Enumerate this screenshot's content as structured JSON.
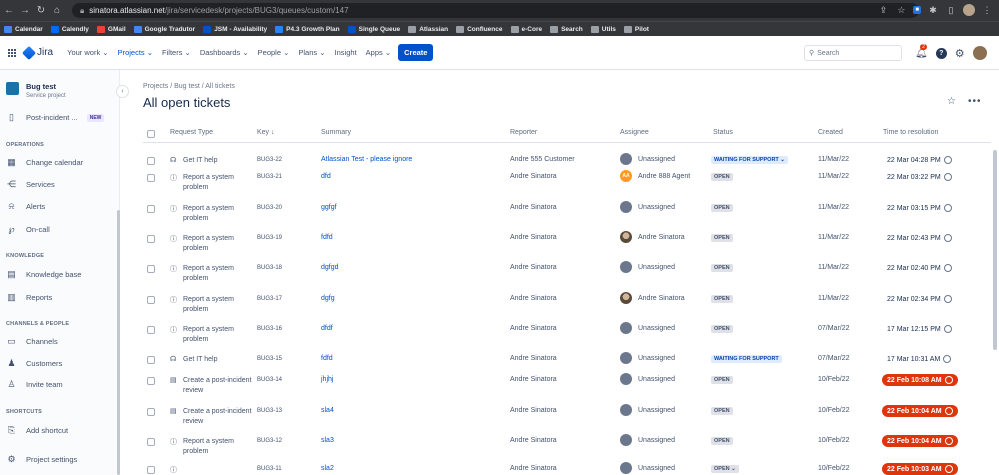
{
  "browser": {
    "url_host": "sinatora.atlassian.net",
    "url_path": "/jira/servicedesk/projects/BUG3/queues/custom/147",
    "bookmarks": [
      "Calendar",
      "Calendly",
      "GMail",
      "Google Tradutor",
      "JSM - Availability",
      "P4.3 Growth Plan",
      "Single Queue",
      "Atlassian",
      "Confluence",
      "e-Core",
      "Search",
      "Utils",
      "Pilot"
    ]
  },
  "nav": {
    "logo": "Jira",
    "items": [
      "Your work ⌄",
      "Projects ⌄",
      "Filters ⌄",
      "Dashboards ⌄",
      "People ⌄",
      "Plans ⌄",
      "Insight",
      "Apps ⌄"
    ],
    "create": "Create",
    "search_placeholder": "Search",
    "notifications": "2"
  },
  "sidebar": {
    "project_name": "Bug test",
    "project_type": "Service project",
    "post_incident": "Post-incident ...",
    "new_badge": "NEW",
    "operations_head": "OPERATIONS",
    "operations": [
      "Change calendar",
      "Services",
      "Alerts",
      "On-call"
    ],
    "knowledge_head": "KNOWLEDGE",
    "knowledge": [
      "Knowledge base",
      "Reports"
    ],
    "channels_head": "CHANNELS & PEOPLE",
    "channels": [
      "Channels",
      "Customers",
      "Invite team"
    ],
    "shortcuts_head": "SHORTCUTS",
    "add_shortcut": "Add shortcut",
    "project_settings": "Project settings"
  },
  "page": {
    "breadcrumb": "Projects  /  Bug test  /  All tickets",
    "title": "All open tickets"
  },
  "table": {
    "headers": [
      "Request Type",
      "Key ↓",
      "Summary",
      "Reporter",
      "Assignee",
      "Status",
      "Created",
      "Time to resolution"
    ],
    "rows": [
      {
        "type": "Get IT help",
        "key": "BUG3-22",
        "summary": "Atlassian Test - please ignore",
        "reporter": "Andre 555 Customer",
        "assignee": "Unassigned",
        "status": "WAITING FOR SUPPORT ⌄",
        "created": "11/Mar/22",
        "ttr": "22 Mar 04:28 PM"
      },
      {
        "type": "Report a system problem",
        "key": "BUG3-21",
        "summary": "dfd",
        "reporter": "Andre Sinatora",
        "assignee": "Andre 888 Agent",
        "status": "OPEN",
        "created": "11/Mar/22",
        "ttr": "22 Mar 03:22 PM"
      },
      {
        "type": "Report a system problem",
        "key": "BUG3-20",
        "summary": "ggfgf",
        "reporter": "Andre Sinatora",
        "assignee": "Unassigned",
        "status": "OPEN",
        "created": "11/Mar/22",
        "ttr": "22 Mar 03:15 PM"
      },
      {
        "type": "Report a system problem",
        "key": "BUG3-19",
        "summary": "fdfd",
        "reporter": "Andre Sinatora",
        "assignee": "Andre Sinatora",
        "status": "OPEN",
        "created": "11/Mar/22",
        "ttr": "22 Mar 02:43 PM"
      },
      {
        "type": "Report a system problem",
        "key": "BUG3-18",
        "summary": "dgfgd",
        "reporter": "Andre Sinatora",
        "assignee": "Unassigned",
        "status": "OPEN",
        "created": "11/Mar/22",
        "ttr": "22 Mar 02:40 PM"
      },
      {
        "type": "Report a system problem",
        "key": "BUG3-17",
        "summary": "dgfg",
        "reporter": "Andre Sinatora",
        "assignee": "Andre Sinatora",
        "status": "OPEN",
        "created": "11/Mar/22",
        "ttr": "22 Mar 02:34 PM"
      },
      {
        "type": "Report a system problem",
        "key": "BUG3-16",
        "summary": "dfdf",
        "reporter": "Andre Sinatora",
        "assignee": "Unassigned",
        "status": "OPEN",
        "created": "07/Mar/22",
        "ttr": "17 Mar 12:15 PM"
      },
      {
        "type": "Get IT help",
        "key": "BUG3-15",
        "summary": "fdfd",
        "reporter": "Andre Sinatora",
        "assignee": "Unassigned",
        "status": "WAITING FOR SUPPORT",
        "created": "07/Mar/22",
        "ttr": "17 Mar 10:31 AM"
      },
      {
        "type": "Create a post-incident review",
        "key": "BUG3-14",
        "summary": "jhjhj",
        "reporter": "Andre Sinatora",
        "assignee": "Unassigned",
        "status": "OPEN",
        "created": "10/Feb/22",
        "ttr": "22 Feb 10:08 AM"
      },
      {
        "type": "Create a post-incident review",
        "key": "BUG3-13",
        "summary": "sla4",
        "reporter": "Andre Sinatora",
        "assignee": "Unassigned",
        "status": "OPEN",
        "created": "10/Feb/22",
        "ttr": "22 Feb 10:04 AM"
      },
      {
        "type": "Report a system problem",
        "key": "BUG3-12",
        "summary": "sla3",
        "reporter": "Andre Sinatora",
        "assignee": "Unassigned",
        "status": "OPEN",
        "created": "10/Feb/22",
        "ttr": "22 Feb 10:04 AM"
      },
      {
        "type": "",
        "key": "BUG3-11",
        "summary": "sla2",
        "reporter": "Andre Sinatora",
        "assignee": "Unassigned",
        "status": "OPEN ⌄",
        "created": "10/Feb/22",
        "ttr": "22 Feb 10:03 AM"
      }
    ]
  },
  "colors": {
    "accent": "#0052cc",
    "breach": "#de350b",
    "waiting": "#deebff"
  }
}
